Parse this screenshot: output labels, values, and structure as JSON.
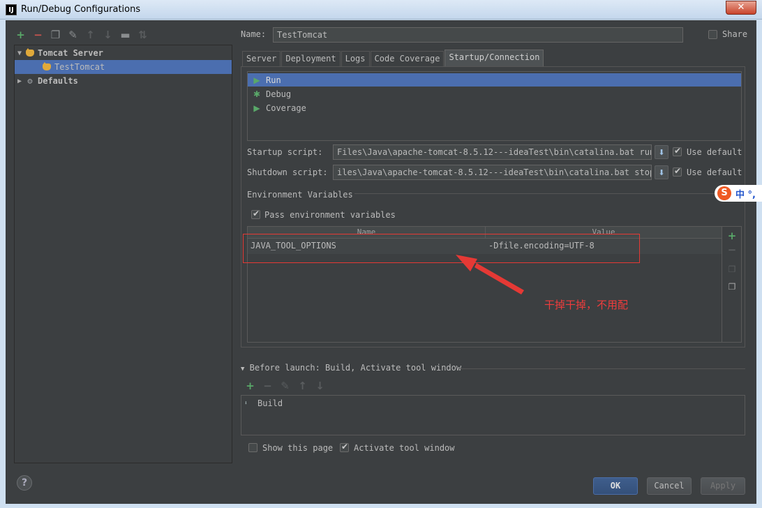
{
  "window": {
    "title": "Run/Debug Configurations",
    "app_icon": "IJ",
    "close_label": "✕"
  },
  "tree": {
    "items": [
      {
        "label": "Tomcat Server",
        "icon": "tomcat-icon",
        "expanded": true
      },
      {
        "label": "TestTomcat",
        "icon": "tomcat-icon",
        "selected": true
      },
      {
        "label": "Defaults",
        "icon": "wrench-icon",
        "expanded": false
      }
    ]
  },
  "left_toolbar": [
    "add-icon",
    "remove-icon",
    "copy-icon",
    "edit-defaults-icon",
    "move-up-icon",
    "move-down-icon",
    "folder-icon",
    "sort-icon"
  ],
  "name_field": {
    "label": "Name:",
    "value": "TestTomcat"
  },
  "share": {
    "label": "Share",
    "checked": false
  },
  "tabs": [
    "Server",
    "Deployment",
    "Logs",
    "Code Coverage",
    "Startup/Connection"
  ],
  "active_tab": "Startup/Connection",
  "modes": [
    {
      "label": "Run",
      "selected": true
    },
    {
      "label": "Debug",
      "selected": false
    },
    {
      "label": "Coverage",
      "selected": false
    }
  ],
  "startup_script": {
    "label": "Startup script:",
    "value": "Files\\Java\\apache-tomcat-8.5.12---ideaTest\\bin\\catalina.bat run",
    "use_default_label": "Use default",
    "use_default": true
  },
  "shutdown_script": {
    "label": "Shutdown script:",
    "value": "iles\\Java\\apache-tomcat-8.5.12---ideaTest\\bin\\catalina.bat stop",
    "use_default_label": "Use default",
    "use_default": true
  },
  "env": {
    "section_label": "Environment Variables",
    "pass_label": "Pass environment variables",
    "pass_checked": true,
    "columns": [
      "Name",
      "Value"
    ],
    "rows": [
      {
        "name": "JAVA_TOOL_OPTIONS",
        "value": "-Dfile.encoding=UTF-8"
      }
    ]
  },
  "annotation": {
    "text": "干掉干掉，不用配",
    "color": "#e53935"
  },
  "ime": {
    "logo": "S",
    "text": "中 °,"
  },
  "before_launch": {
    "label": "Before launch: Build, Activate tool window",
    "items": [
      "Build"
    ]
  },
  "bottom_options": {
    "show_page_label": "Show this page",
    "show_page_checked": false,
    "activate_label": "Activate tool window",
    "activate_checked": true
  },
  "buttons": {
    "ok": "OK",
    "cancel": "Cancel",
    "apply": "Apply",
    "help": "?"
  },
  "colors": {
    "bg": "#3c3f41",
    "selection": "#4b6eaf",
    "add_green": "#59a869",
    "remove_red": "#c75450"
  }
}
